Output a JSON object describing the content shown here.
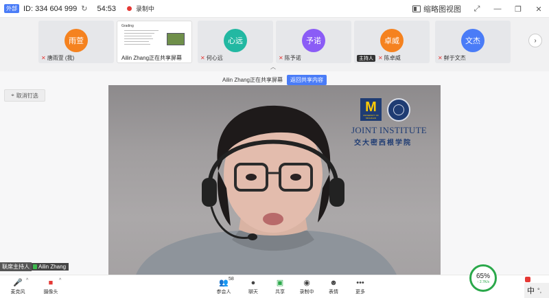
{
  "titlebar": {
    "external_badge": "外部",
    "meeting_id": "ID: 334 604 999",
    "copy_icon": "↻",
    "duration": "54:53",
    "recording_label": "录制中",
    "view_label": "缩略图视图",
    "expand_icon": "⤢",
    "minimize_icon": "—",
    "restore_icon": "❐",
    "close_icon": "✕"
  },
  "participants": [
    {
      "avatar": "雨萱",
      "name": "唐雨萱 (我)",
      "color": "#f5821f",
      "host": false
    },
    {
      "avatar": "心远",
      "name": "何心远",
      "color": "#22b8a2",
      "host": false
    },
    {
      "avatar": "予诺",
      "name": "陈予诺",
      "color": "#8b5cf6",
      "host": false
    },
    {
      "avatar": "卓威",
      "name": "陈卓威",
      "color": "#f5821f",
      "host": true
    },
    {
      "avatar": "文杰",
      "name": "鲜于文杰",
      "color": "#4a7cf7",
      "host": false
    }
  ],
  "host_badge": "主持人",
  "share_tile": {
    "label": "Ailin Zhang正在共享屏幕",
    "thumb_title": "Grading"
  },
  "next_icon": "›",
  "collapse_icon": "︿",
  "main": {
    "sharing_text": "Ailin Zhang正在共享屏幕",
    "return_button": "返回共享内容",
    "unpin_label": "取消钉选",
    "unpin_icon": "⌖"
  },
  "video": {
    "logo_letter": "M",
    "logo_sub": "UNIVERSITY OF MICHIGAN",
    "institute_en": "JOINT INSTITUTE",
    "institute_cn": "交大密西根学院",
    "name_host": "联席主持人",
    "name_person": "Ailin Zhang"
  },
  "toolbar": {
    "mic_label": "麦克风",
    "mic_icon": "🎤",
    "camera_label": "摄像头",
    "camera_icon": "■",
    "participants_label": "参会人",
    "participants_count": "58",
    "participants_icon": "👥",
    "chat_label": "聊天",
    "chat_icon": "●",
    "share_label": "共享",
    "share_icon": "▣",
    "record_label": "录制中",
    "record_icon": "◉",
    "reaction_label": "表情",
    "reaction_icon": "☻",
    "more_label": "更多",
    "more_icon": "•••",
    "caret": "^"
  },
  "network": {
    "percent": "65%",
    "speed": "↑ 2.7K/s"
  },
  "ime": {
    "label": "中",
    "mark": "°,"
  }
}
